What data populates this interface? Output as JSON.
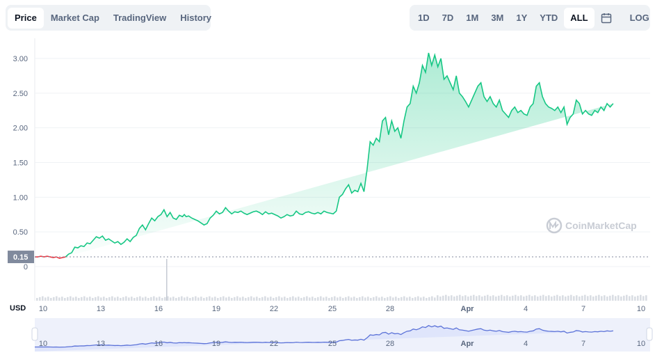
{
  "left_tabs": [
    "Price",
    "Market Cap",
    "TradingView",
    "History"
  ],
  "left_active": "Price",
  "range_tabs": [
    "1D",
    "7D",
    "1M",
    "3M",
    "1Y",
    "YTD",
    "ALL"
  ],
  "range_active": "ALL",
  "calendar_icon": "calendar-icon",
  "log_label": "LOG",
  "currency_label": "USD",
  "price_badge": "0.15",
  "watermark": "CoinMarketCap",
  "colors": {
    "up": "#16c784",
    "down": "#ea3943",
    "nav_line": "#5b72d8",
    "nav_fill": "#dfe5fb",
    "badge": "#808a9d"
  },
  "chart_data": {
    "type": "line",
    "title": "",
    "xlabel": "",
    "ylabel": "",
    "y_ticks": [
      "0",
      "0.50",
      "1.00",
      "1.50",
      "2.00",
      "2.50",
      "3.00"
    ],
    "ylim": [
      0,
      3.2
    ],
    "x_ticks": [
      "10",
      "13",
      "16",
      "19",
      "22",
      "25",
      "28",
      "Apr",
      "4",
      "7",
      "10"
    ],
    "x": [
      0,
      0.5,
      1,
      1.5,
      2,
      2.5,
      3,
      3.5,
      4,
      4.5,
      5,
      5.5,
      6,
      6.5,
      7,
      7.5,
      8,
      8.5,
      9,
      9.5,
      10,
      10.5,
      11,
      11.5,
      12,
      12.5,
      13,
      13.5,
      14,
      14.5,
      15,
      15.5,
      16,
      16.5,
      17,
      17.5,
      18,
      18.5,
      19,
      19.5,
      20,
      20.5,
      21,
      21.5,
      22,
      22.5,
      23,
      23.5,
      24,
      24.3,
      24.6,
      25,
      25.5,
      26,
      26.5,
      27,
      27.5,
      28,
      28.5,
      29,
      29.5,
      30,
      30.5,
      31,
      31.5,
      32,
      32.5,
      33,
      33.5,
      34,
      34.5,
      35,
      35.5,
      36,
      36.5,
      37,
      37.5,
      38,
      38.5,
      39,
      39.5,
      40,
      40.5,
      41,
      41.5,
      42,
      42.5,
      43,
      43.5,
      44,
      44.5,
      45,
      45.5,
      46,
      46.5,
      47,
      47.5,
      48,
      48.5,
      49,
      49.5,
      50,
      50.5,
      51,
      51.5,
      52,
      52.5,
      53,
      53.5,
      54,
      54.5,
      55,
      55.5,
      56,
      56.5,
      57,
      57.5,
      58,
      58.5,
      59,
      59.5,
      60,
      60.5,
      61,
      61.5,
      62,
      62.5,
      63,
      63.5,
      64,
      64.5,
      65,
      65.5,
      66,
      66.5,
      67,
      67.5,
      68,
      68.5,
      69,
      69.5,
      70,
      70.5,
      71,
      71.5,
      72,
      72.5,
      73,
      73.5,
      74,
      74.5,
      75,
      75.5,
      76,
      76.5,
      77,
      77.5,
      78,
      78.5,
      79,
      79.5,
      80,
      80.5,
      81,
      81.5,
      82,
      82.5,
      83,
      83.5,
      84,
      84.5,
      85,
      85.5,
      86,
      86.5,
      87,
      87.5,
      88,
      88.5,
      89,
      89.5,
      90,
      90.5,
      91,
      91.5,
      92,
      92.5,
      93,
      93.5,
      94,
      94.5,
      95,
      95.5,
      96,
      96.5,
      97,
      97.5,
      98,
      98.5,
      99,
      99.5,
      100
    ],
    "series": [
      {
        "values": [
          0.14,
          0.14,
          0.15,
          0.14,
          0.15,
          0.14,
          0.13,
          0.14,
          0.12,
          0.13,
          0.14,
          0.18,
          0.2,
          0.28,
          0.27,
          0.3,
          0.29,
          0.34,
          0.33,
          0.38,
          0.43,
          0.41,
          0.44,
          0.38,
          0.4,
          0.37,
          0.34,
          0.36,
          0.32,
          0.35,
          0.4,
          0.36,
          0.42,
          0.45,
          0.55,
          0.6,
          0.53,
          0.62,
          0.7,
          0.66,
          0.72,
          0.75,
          0.82,
          0.72,
          0.78,
          0.7,
          0.68,
          0.74,
          0.72,
          0.75,
          0.72,
          0.73,
          0.7,
          0.68,
          0.66,
          0.63,
          0.6,
          0.62,
          0.7,
          0.74,
          0.8,
          0.76,
          0.78,
          0.85,
          0.8,
          0.76,
          0.79,
          0.78,
          0.8,
          0.77,
          0.75,
          0.77,
          0.79,
          0.8,
          0.78,
          0.75,
          0.79,
          0.76,
          0.77,
          0.75,
          0.73,
          0.7,
          0.72,
          0.75,
          0.73,
          0.74,
          0.8,
          0.76,
          0.75,
          0.78,
          0.79,
          0.77,
          0.76,
          0.78,
          0.76,
          0.8,
          0.78,
          0.77,
          0.76,
          0.8,
          1.0,
          1.04,
          1.12,
          1.18,
          1.06,
          1.1,
          1.08,
          1.2,
          1.08,
          1.4,
          1.8,
          1.75,
          1.85,
          1.8,
          2.1,
          2.15,
          1.9,
          2.1,
          1.95,
          2.0,
          1.85,
          2.1,
          2.3,
          2.35,
          2.6,
          2.5,
          2.65,
          2.9,
          2.8,
          3.08,
          2.9,
          3.05,
          2.88,
          3.0,
          2.7,
          2.75,
          2.65,
          2.55,
          2.75,
          2.5,
          2.45,
          2.38,
          2.3,
          2.4,
          2.5,
          2.6,
          2.65,
          2.45,
          2.38,
          2.45,
          2.35,
          2.3,
          2.4,
          2.25,
          2.2,
          2.15,
          2.25,
          2.3,
          2.22,
          2.25,
          2.2,
          2.18,
          2.3,
          2.35,
          2.6,
          2.65,
          2.45,
          2.35,
          2.3,
          2.28,
          2.25,
          2.3,
          2.22,
          2.3,
          2.05,
          2.15,
          2.2,
          2.4,
          2.35,
          2.2,
          2.25,
          2.2,
          2.18,
          2.25,
          2.22,
          2.3,
          2.25,
          2.35,
          2.3,
          2.35
        ]
      }
    ],
    "legend": "none",
    "grid": true
  }
}
